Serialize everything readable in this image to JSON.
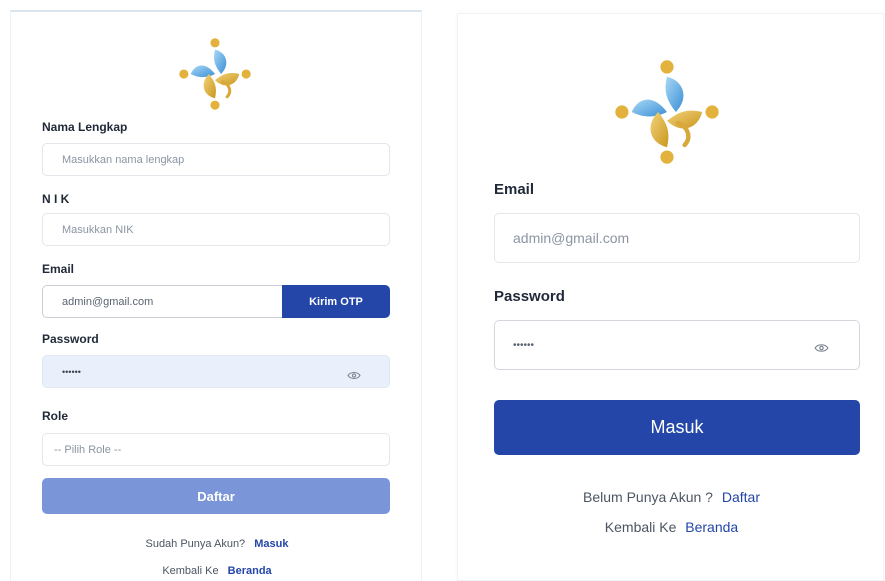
{
  "register": {
    "fields": {
      "name": {
        "label": "Nama Lengkap",
        "placeholder": "Masukkan nama lengkap"
      },
      "nik": {
        "label": "N I K",
        "placeholder": "Masukkan NIK"
      },
      "email": {
        "label": "Email",
        "value": "admin@gmail.com",
        "otp_button": "Kirim OTP"
      },
      "password": {
        "label": "Password",
        "value": "••••••"
      },
      "role": {
        "label": "Role",
        "selected": "-- Pilih Role --"
      }
    },
    "submit_label": "Daftar",
    "footer": {
      "prompt": "Sudah Punya Akun?",
      "login_link": "Masuk",
      "back_prefix": "Kembali Ke",
      "home_link": "Beranda"
    }
  },
  "login": {
    "fields": {
      "email": {
        "label": "Email",
        "value": "admin@gmail.com"
      },
      "password": {
        "label": "Password",
        "value": "••••••"
      }
    },
    "submit_label": "Masuk",
    "footer": {
      "prompt": "Belum Punya Akun ?",
      "register_link": "Daftar",
      "back_prefix": "Kembali Ke",
      "home_link": "Beranda"
    }
  },
  "colors": {
    "primary": "#2346a8",
    "primary_disabled": "#7b96d8",
    "logo_blue": "#4aa3de",
    "logo_gold": "#e2b23c",
    "input_filled_bg": "#e9f0fb"
  },
  "icons": {
    "logo": "people-circle-logo",
    "password_toggle": "eye-icon"
  }
}
